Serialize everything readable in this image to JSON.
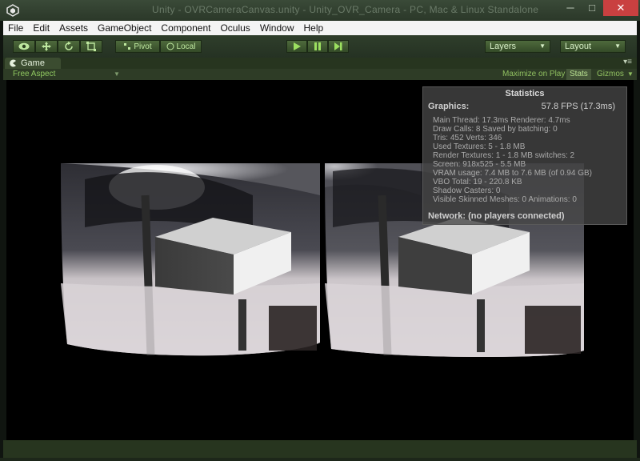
{
  "window": {
    "title": "Unity - OVRCameraCanvas.unity - Unity_OVR_Camera - PC, Mac & Linux Standalone",
    "minimize_glyph": "─",
    "maximize_glyph": "□",
    "close_glyph": "✕"
  },
  "menu": {
    "items": [
      "File",
      "Edit",
      "Assets",
      "GameObject",
      "Component",
      "Oculus",
      "Window",
      "Help"
    ]
  },
  "toolbar": {
    "tools": [
      "view-eye-icon",
      "move-icon",
      "rotate-icon",
      "scale-icon"
    ],
    "pivot_label": "Pivot",
    "local_label": "Local",
    "layers_label": "Layers",
    "layout_label": "Layout"
  },
  "game_tab": {
    "label": "Game",
    "aspect": "Free Aspect",
    "maximize_label": "Maximize on Play",
    "stats_label": "Stats",
    "gizmos_label": "Gizmos"
  },
  "stats": {
    "title": "Statistics",
    "graphics_label": "Graphics:",
    "fps": "57.8 FPS (17.3ms)",
    "lines": [
      "Main Thread: 17.3ms  Renderer: 4.7ms",
      "Draw Calls: 8   Saved by batching: 0",
      "Tris: 452  Verts: 346",
      "Used Textures: 5 - 1.8 MB",
      "Render Textures: 1 - 1.8 MB  switches: 2",
      "Screen: 918x525 - 5.5 MB",
      "VRAM usage: 7.4 MB to 7.6 MB (of 0.94 GB)",
      "VBO Total: 19 - 220.8 KB",
      "Shadow Casters: 0",
      "Visible Skinned Meshes: 0        Animations: 0"
    ],
    "network": "Network: (no players connected)"
  },
  "colors": {
    "accent_green": "#8fc860",
    "close_red": "#c94040",
    "menu_bg": "#f4f4f4"
  }
}
